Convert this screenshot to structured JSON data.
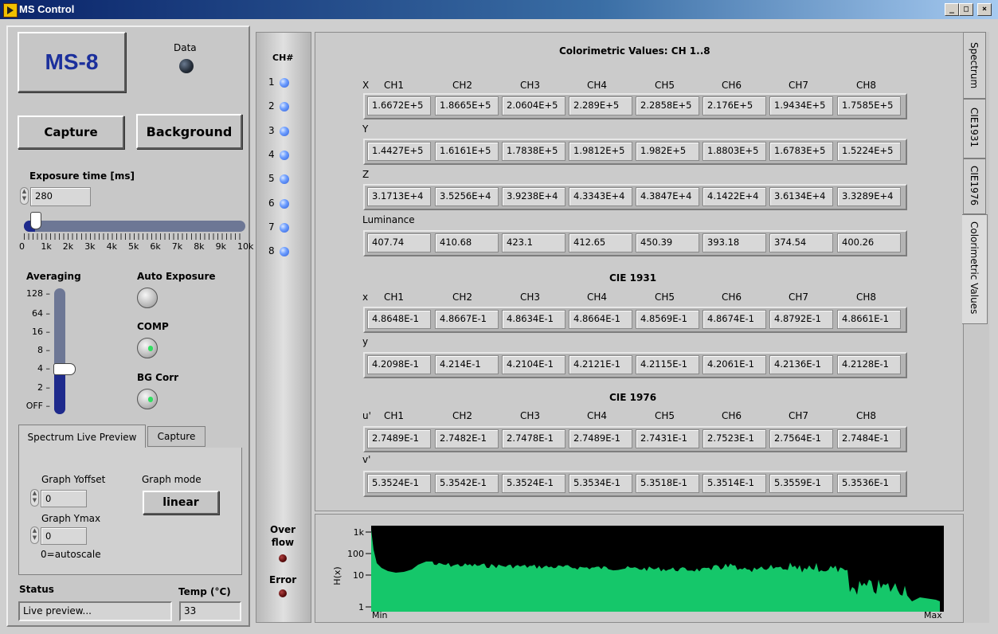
{
  "window": {
    "title": "MS Control",
    "min_btn": "_",
    "max_btn": "□",
    "close_btn": "×"
  },
  "device": {
    "label": "MS-8",
    "data_label": "Data"
  },
  "buttons": {
    "capture": "Capture",
    "background": "Background"
  },
  "exposure": {
    "label": "Exposure time [ms]",
    "value": "280",
    "slider_fraction": 0.028,
    "ticks": [
      "0",
      "1k",
      "2k",
      "3k",
      "4k",
      "5k",
      "6k",
      "7k",
      "8k",
      "9k",
      "10k"
    ]
  },
  "averaging": {
    "label": "Averaging",
    "ticks": [
      "128",
      "64",
      "16",
      "8",
      "4",
      "2",
      "OFF"
    ],
    "selected": "4"
  },
  "auto_exposure": {
    "label": "Auto Exposure",
    "on": false
  },
  "comp": {
    "label": "COMP",
    "on": true
  },
  "bg_corr": {
    "label": "BG Corr",
    "on": true
  },
  "preview_tabs": [
    "Spectrum Live Preview",
    "Capture"
  ],
  "preview": {
    "yoffset_label": "Graph Yoffset",
    "yoffset_value": "0",
    "ymax_label": "Graph Ymax",
    "ymax_value": "0",
    "graph_mode_label": "Graph mode",
    "graph_mode_value": "linear",
    "autoscale_note": "0=autoscale"
  },
  "status": {
    "label": "Status",
    "value": "Live preview...",
    "temp_label": "Temp (°C)",
    "temp_value": "33"
  },
  "channels": {
    "header": "CH#",
    "items": [
      "1",
      "2",
      "3",
      "4",
      "5",
      "6",
      "7",
      "8"
    ],
    "overflow_label": "Over\nflow",
    "error_label": "Error"
  },
  "side_tabs": [
    "Spectrum",
    "CIE1931",
    "CIE1976",
    "Colorimetric Values"
  ],
  "colorimetric": {
    "title": "Colorimetric Values: CH 1..8",
    "ch_headers": [
      "CH1",
      "CH2",
      "CH3",
      "CH4",
      "CH5",
      "CH6",
      "CH7",
      "CH8"
    ],
    "X": {
      "label": "X",
      "values": [
        "1.6672E+5",
        "1.8665E+5",
        "2.0604E+5",
        "2.289E+5",
        "2.2858E+5",
        "2.176E+5",
        "1.9434E+5",
        "1.7585E+5"
      ]
    },
    "Y": {
      "label": "Y",
      "values": [
        "1.4427E+5",
        "1.6161E+5",
        "1.7838E+5",
        "1.9812E+5",
        "1.982E+5",
        "1.8803E+5",
        "1.6783E+5",
        "1.5224E+5"
      ]
    },
    "Z": {
      "label": "Z",
      "values": [
        "3.1713E+4",
        "3.5256E+4",
        "3.9238E+4",
        "4.3343E+4",
        "4.3847E+4",
        "4.1422E+4",
        "3.6134E+4",
        "3.3289E+4"
      ]
    },
    "Luminance": {
      "label": "Luminance",
      "values": [
        "407.74",
        "410.68",
        "423.1",
        "412.65",
        "450.39",
        "393.18",
        "374.54",
        "400.26"
      ]
    }
  },
  "cie1931": {
    "title": "CIE 1931",
    "x": {
      "label": "x",
      "values": [
        "4.8648E-1",
        "4.8667E-1",
        "4.8634E-1",
        "4.8664E-1",
        "4.8569E-1",
        "4.8674E-1",
        "4.8792E-1",
        "4.8661E-1"
      ]
    },
    "y": {
      "label": "y",
      "values": [
        "4.2098E-1",
        "4.214E-1",
        "4.2104E-1",
        "4.2121E-1",
        "4.2115E-1",
        "4.2061E-1",
        "4.2136E-1",
        "4.2128E-1"
      ]
    }
  },
  "cie1976": {
    "title": "CIE 1976",
    "u": {
      "label": "u'",
      "values": [
        "2.7489E-1",
        "2.7482E-1",
        "2.7478E-1",
        "2.7489E-1",
        "2.7431E-1",
        "2.7523E-1",
        "2.7564E-1",
        "2.7484E-1"
      ]
    },
    "v": {
      "label": "v'",
      "values": [
        "5.3524E-1",
        "5.3542E-1",
        "5.3524E-1",
        "5.3534E-1",
        "5.3518E-1",
        "5.3514E-1",
        "5.3559E-1",
        "5.3536E-1"
      ]
    }
  },
  "spectrum_graph": {
    "ylabel": "H(x)",
    "yticks": [
      "1k",
      "100",
      "10",
      "1"
    ],
    "xmin_label": "Min",
    "xmax_label": "Max",
    "fill_color": "#15c76a"
  }
}
